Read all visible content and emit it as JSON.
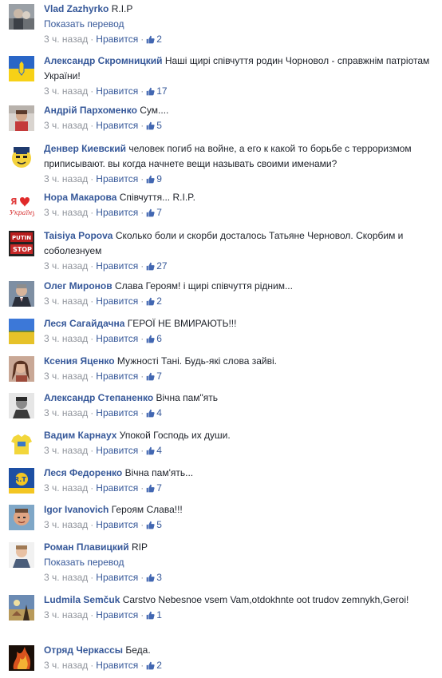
{
  "labels": {
    "like": "Нравится",
    "time": "3 ч. назад",
    "dot": "·",
    "translate": "Показать перевод"
  },
  "colors": {
    "author": "#365899",
    "meta": "#90949c",
    "text": "#1d2129"
  },
  "comments": [
    {
      "author": "Vlad Zazhyrko",
      "text": "R.I.P",
      "likes": "2",
      "translate": true,
      "avatar": "photo-grey"
    },
    {
      "author": "Александр Скромницкий",
      "text": "Наші щирі співчуття родин Чорновол - справжнім патріотам України!",
      "likes": "17",
      "translate": false,
      "avatar": "flag-ukraine"
    },
    {
      "author": "Андрій Пархоменко",
      "text": "Сум....",
      "likes": "5",
      "translate": false,
      "avatar": "photo-red"
    },
    {
      "author": "Денвер Киевский",
      "text": "человек погиб на войне, а его к какой то борьбе с терроризмом приписывают. вы когда начнете вещи называть своими именами?",
      "likes": "9",
      "translate": false,
      "avatar": "smiley-police"
    },
    {
      "author": "Нора Макарова",
      "text": "Співчуття... R.I.P.",
      "likes": "7",
      "translate": false,
      "avatar": "love-ukraine"
    },
    {
      "author": "Taisiya Popova",
      "text": "Сколько боли и скорби досталось Татьяне Черновол. Скорбим и соболезнуем",
      "likes": "27",
      "translate": false,
      "avatar": "stop-sign"
    },
    {
      "author": "Олег Миронов",
      "text": "Слава Героям! і щирі співчуття рідним...",
      "likes": "2",
      "translate": false,
      "avatar": "photo-man-suit"
    },
    {
      "author": "Леся Сагайдачна",
      "text": "ГЕРОЇ НЕ ВМИРАЮТЬ!!!",
      "likes": "6",
      "translate": false,
      "avatar": "field-blue-yellow"
    },
    {
      "author": "Ксения Яценко",
      "text": "Мужності Тані. Будь-які слова зайві.",
      "likes": "7",
      "translate": false,
      "avatar": "photo-woman"
    },
    {
      "author": "Александр Степаненко",
      "text": "Вічна пам\"ять",
      "likes": "4",
      "translate": false,
      "avatar": "photo-bw"
    },
    {
      "author": "Вадим Карнаух",
      "text": "Упокой Господь их души.",
      "likes": "4",
      "translate": false,
      "avatar": "yellow-shirt"
    },
    {
      "author": "Леся Федоренко",
      "text": "Вічна пам'ять...",
      "likes": "7",
      "translate": false,
      "avatar": "blue-badge"
    },
    {
      "author": "Igor Ivanovich",
      "text": "Героям Слава!!!",
      "likes": "5",
      "translate": false,
      "avatar": "photo-face"
    },
    {
      "author": "Роман Плавицкий",
      "text": "RIP",
      "likes": "3",
      "translate": true,
      "avatar": "photo-man-light"
    },
    {
      "author": "Ludmila Semčuk",
      "text": "Carstvo Nebesnoe vsem Vam,otdokhnte oot trudov zemnykh,Geroi!",
      "likes": "1",
      "translate": false,
      "avatar": "painting"
    },
    {
      "author": "Отряд Черкассы",
      "text": "Беда.",
      "likes": "2",
      "translate": false,
      "avatar": "fire-dark"
    }
  ]
}
